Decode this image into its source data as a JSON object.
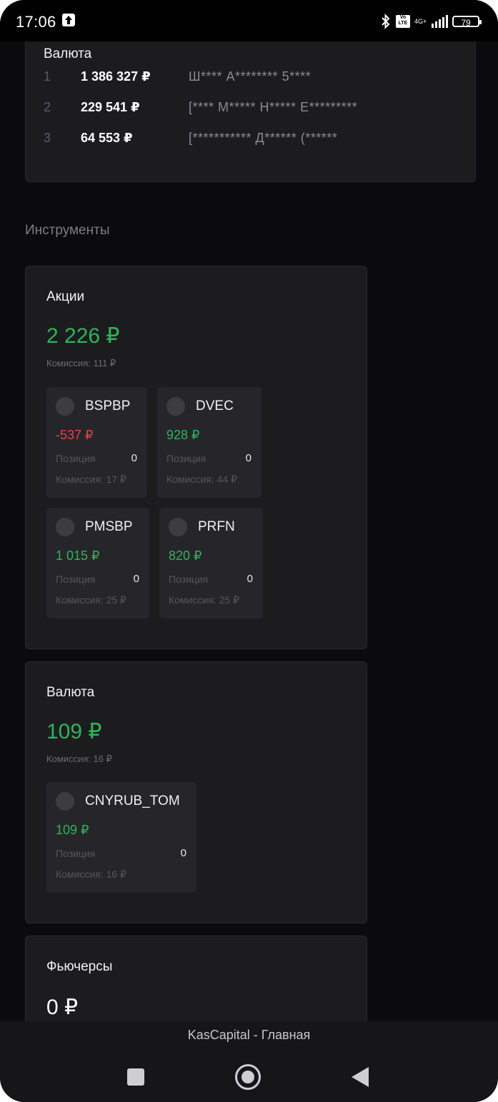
{
  "status_bar": {
    "time": "17:06",
    "network": "4G+",
    "battery": "79"
  },
  "top_card": {
    "title": "Валюта",
    "rows": [
      {
        "rank": "1",
        "amount": "1 386 327 ₽",
        "name": "Ш**** А******** 5****"
      },
      {
        "rank": "2",
        "amount": "229 541 ₽",
        "name": "[**** М***** Н***** Е*********"
      },
      {
        "rank": "3",
        "amount": "64 553 ₽",
        "name": "[*********** Д****** (******"
      }
    ]
  },
  "section_title": "Инструменты",
  "groups": [
    {
      "title": "Акции",
      "total": "2 226 ₽",
      "fee": "Комиссия: 111 ₽",
      "instruments": [
        {
          "name": "BSPBP",
          "pnl": "-537 ₽",
          "pnl_sign": "neg",
          "position_label": "Позиция",
          "position": "0",
          "fee": "Комиссия: 17 ₽"
        },
        {
          "name": "DVEC",
          "pnl": "928 ₽",
          "pnl_sign": "pos",
          "position_label": "Позиция",
          "position": "0",
          "fee": "Комиссия: 44 ₽"
        },
        {
          "name": "PMSBP",
          "pnl": "1 015 ₽",
          "pnl_sign": "pos",
          "position_label": "Позиция",
          "position": "0",
          "fee": "Комиссия: 25 ₽"
        },
        {
          "name": "PRFN",
          "pnl": "820 ₽",
          "pnl_sign": "pos",
          "position_label": "Позиция",
          "position": "0",
          "fee": "Комиссия: 25 ₽"
        }
      ]
    },
    {
      "title": "Валюта",
      "total": "109 ₽",
      "fee": "Комиссия: 16 ₽",
      "instruments": [
        {
          "name": "CNYRUB_TOM",
          "pnl": "109 ₽",
          "pnl_sign": "pos",
          "position_label": "Позиция",
          "position": "0",
          "fee": "Комиссия: 16 ₽"
        }
      ]
    },
    {
      "title": "Фьючерсы",
      "total": "0 ₽"
    }
  ],
  "bottom_bar": {
    "app_title": "KasCapital - Главная"
  },
  "colors": {
    "positive": "#2fb35a",
    "negative": "#e04646",
    "card_bg": "#1c1c1f",
    "page_bg": "#0b0b0d"
  }
}
